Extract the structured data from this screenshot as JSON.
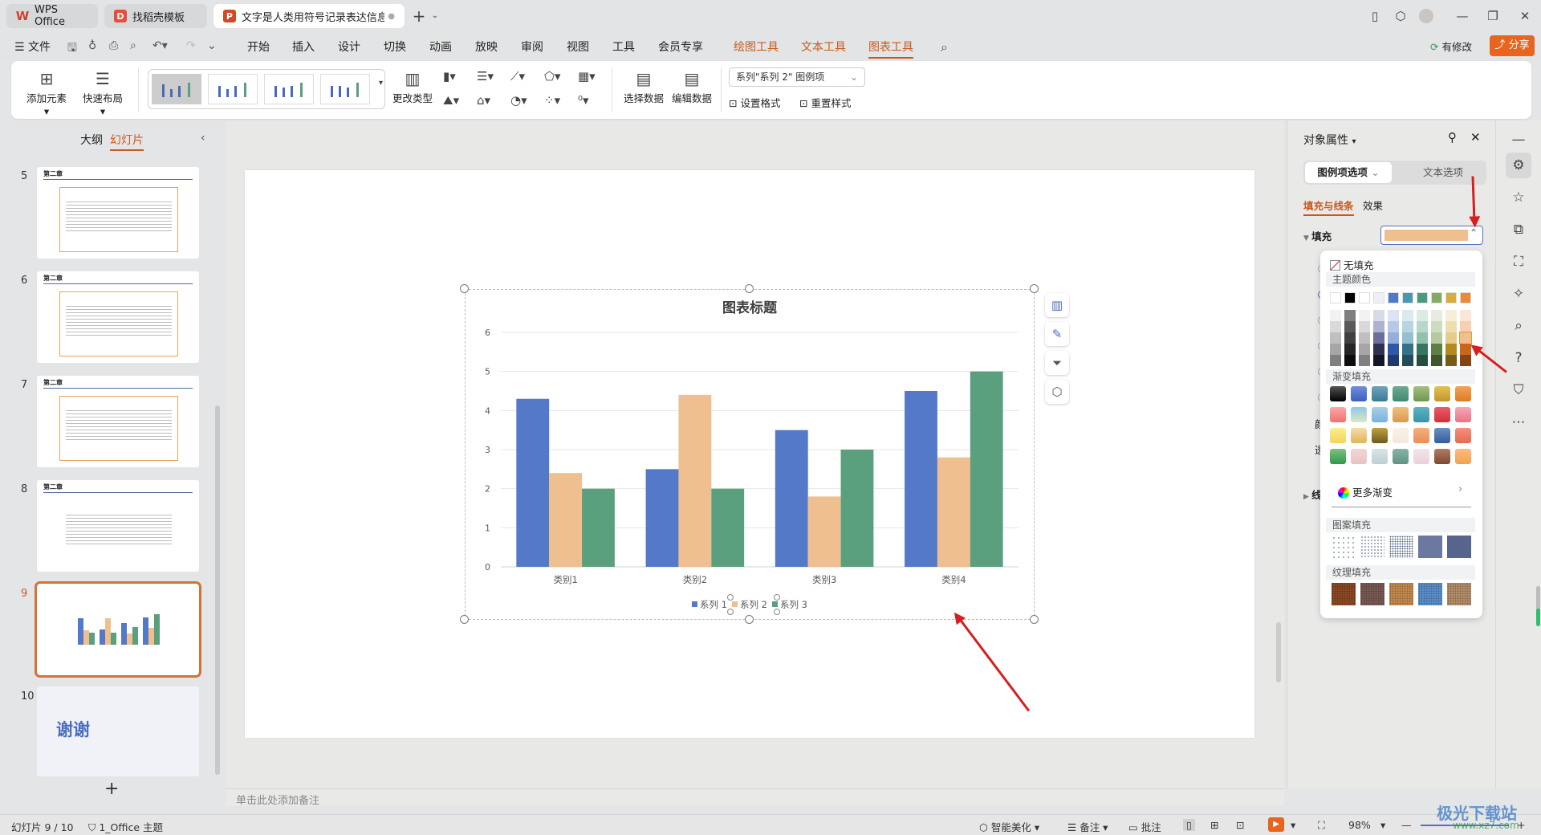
{
  "tabs": [
    {
      "label": "WPS Office",
      "icon": "wps-logo-icon",
      "color": "#d83b2e"
    },
    {
      "label": "找稻壳模板",
      "icon": "docer-logo-icon",
      "color": "#e84c3d"
    },
    {
      "label": "文字是人类用符号记录表达信息以",
      "icon": "ppt-logo-icon",
      "color": "#d24726",
      "modified": "●"
    }
  ],
  "new_tab": "+",
  "menu": {
    "file": "文件",
    "items": [
      "开始",
      "插入",
      "设计",
      "切换",
      "动画",
      "放映",
      "审阅",
      "视图",
      "工具",
      "会员专享"
    ],
    "context_items": [
      "绘图工具",
      "文本工具",
      "图表工具"
    ],
    "active": "图表工具",
    "modified_status": "有修改",
    "share": "分享"
  },
  "ribbon": {
    "add_element": "添加元素",
    "quick_layout": "快速布局",
    "change_type": "更改类型",
    "select_data": "选择数据",
    "edit_data": "编辑数据",
    "element_selector": "系列\"系列 2\" 图例项",
    "set_format": "设置格式",
    "reset_style": "重置样式"
  },
  "left_panel": {
    "tab_outline": "大纲",
    "tab_slides": "幻灯片",
    "slides": [
      {
        "num": "5",
        "title": "第二章"
      },
      {
        "num": "6",
        "title": "第二章"
      },
      {
        "num": "7",
        "title": "第二章"
      },
      {
        "num": "8",
        "title": "第二章"
      },
      {
        "num": "9",
        "title": ""
      },
      {
        "num": "10",
        "title": "谢谢"
      }
    ],
    "selected": "9",
    "add": "+"
  },
  "notes_placeholder": "单击此处添加备注",
  "chart_data": {
    "type": "bar",
    "title": "图表标题",
    "categories": [
      "类别1",
      "类别2",
      "类别3",
      "类别4"
    ],
    "series": [
      {
        "name": "系列 1",
        "color": "#5579c9",
        "values": [
          4.3,
          2.5,
          3.5,
          4.5
        ]
      },
      {
        "name": "系列 2",
        "color": "#efbf8f",
        "values": [
          2.4,
          4.4,
          1.8,
          2.8
        ]
      },
      {
        "name": "系列 3",
        "color": "#5aa07f",
        "values": [
          2,
          2,
          3,
          5
        ]
      }
    ],
    "ylim": [
      0,
      6
    ],
    "yticks": [
      "0",
      "1",
      "2",
      "3",
      "4",
      "5",
      "6"
    ],
    "grid": true,
    "legend": "bottom",
    "xlabel": "",
    "ylabel": ""
  },
  "props_pane": {
    "title": "对象属性",
    "tab_legend": "图例项选项",
    "tab_text": "文本选项",
    "sub_fill_line": "填充与线条",
    "sub_effect": "效果",
    "fill_label": "填充",
    "fill_color": "#efbf8f",
    "color_label": "颜",
    "transp_label": "透",
    "line_label": "线"
  },
  "color_popup": {
    "no_fill": "无填充",
    "theme_colors": "主题颜色",
    "theme_row": [
      "#ffffff",
      "#000000",
      "#ffffff",
      "#eef0f4",
      "#4f7ac7",
      "#4a98b0",
      "#4a9a7e",
      "#86a966",
      "#d6ac3e",
      "#e88a3a"
    ],
    "shade_cols": [
      [
        "#f2f2f2",
        "#d9d9d9",
        "#bfbfbf",
        "#a6a6a6",
        "#808080"
      ],
      [
        "#7f7f7f",
        "#595959",
        "#404040",
        "#262626",
        "#0d0d0d"
      ],
      [
        "#f2f2f2",
        "#d9d9d9",
        "#bfbfbf",
        "#a6a6a6",
        "#808080"
      ],
      [
        "#d8dbe7",
        "#aeb1cf",
        "#6c6f9c",
        "#2f3150",
        "#141626"
      ],
      [
        "#dce4f3",
        "#b8c9e8",
        "#95afdd",
        "#2f57a9",
        "#203a71"
      ],
      [
        "#daeaef",
        "#b6d5df",
        "#92c1cf",
        "#35728a",
        "#244c5c"
      ],
      [
        "#daebe4",
        "#b6d7c9",
        "#92c2ae",
        "#357662",
        "#244f41"
      ],
      [
        "#e6ede0",
        "#cddbc1",
        "#b5caa3",
        "#5e7f43",
        "#3f552d"
      ],
      [
        "#f7eed8",
        "#efddb2",
        "#e6cc8b",
        "#b28a1f",
        "#775c15"
      ],
      [
        "#fbe7d8",
        "#f6d0b1",
        "#efbf8f",
        "#c9661c",
        "#874413"
      ]
    ],
    "selected_color": "#efbf8f",
    "gradient_fill": "渐变填充",
    "gradients": [
      [
        "#555",
        "#000"
      ],
      [
        "#6f8fe0",
        "#3d5fbf"
      ],
      [
        "#6ea4bd",
        "#3a7a96"
      ],
      [
        "#6cab94",
        "#3f8a70"
      ],
      [
        "#a3c07f",
        "#6f9650"
      ],
      [
        "#e6c157",
        "#c0962b"
      ],
      [
        "#f3a45a",
        "#de7a22"
      ],
      [
        "#ffa6a6",
        "#f07070"
      ],
      [
        "#8fc9e8",
        "#d9e8c2"
      ],
      [
        "#a8cfe8",
        "#78b2da"
      ],
      [
        "#f0c07c",
        "#d79a4b"
      ],
      [
        "#5fb4c3",
        "#3a93a6"
      ],
      [
        "#ec5b6b",
        "#d22e3a"
      ],
      [
        "#f7a8b6",
        "#e87485"
      ],
      [
        "#fcec8e",
        "#f5d45a"
      ],
      [
        "#f6dda6",
        "#e0b25c"
      ],
      [
        "#c0a040",
        "#6f5a1c"
      ],
      [
        "#faf0e6",
        "#f2e8dc"
      ],
      [
        "#f4b07d",
        "#e88d58"
      ],
      [
        "#6a8fc3",
        "#345e98"
      ],
      [
        "#f58f7a",
        "#e76a52"
      ],
      [
        "#80c080",
        "#2d9a48"
      ],
      [
        "#f3d6d6",
        "#e8c2c2"
      ],
      [
        "#d9e4e6",
        "#bccfd2"
      ],
      [
        "#88b3a5",
        "#5e9484"
      ],
      [
        "#f4e4ea",
        "#e6d2db"
      ],
      [
        "#b27a63",
        "#7c4a33"
      ],
      [
        "#fbbd7a",
        "#f3a252"
      ]
    ],
    "more_gradients": "更多渐变",
    "pattern_fill": "图案填充",
    "texture_fill": "纹理填充",
    "textures": [
      "#8b4a23",
      "#7a5a55",
      "#c58a4f",
      "#5b8fcb",
      "#b58d68"
    ]
  },
  "status": {
    "slide_pos": "幻灯片 9 / 10",
    "theme": "1_Office 主题",
    "smart_beautify": "智能美化",
    "notes": "备注",
    "comments": "批注",
    "zoom": "98%",
    "watermark": "极光下载站",
    "watermark_url": "www.xz7.com"
  }
}
